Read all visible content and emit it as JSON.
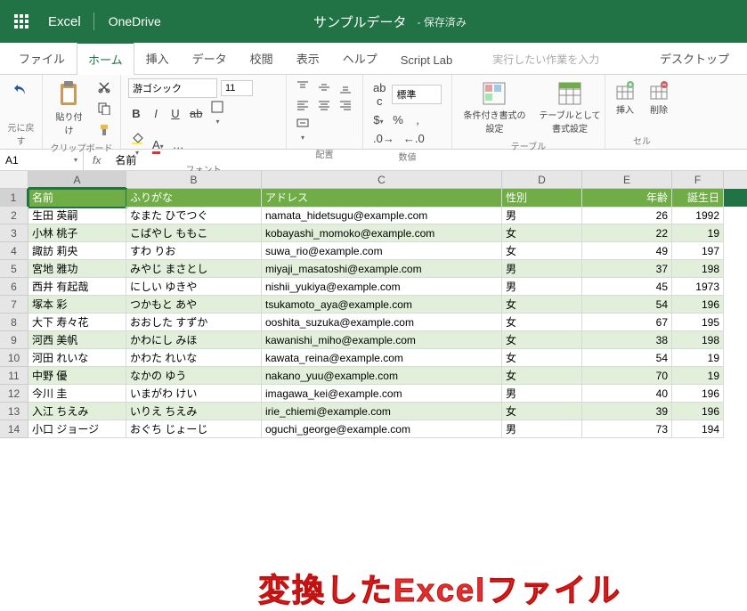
{
  "header": {
    "app": "Excel",
    "brand": "OneDrive",
    "title": "サンプルデータ",
    "status": "- 保存済み"
  },
  "tabs": [
    "ファイル",
    "ホーム",
    "挿入",
    "データ",
    "校閲",
    "表示",
    "ヘルプ",
    "Script Lab"
  ],
  "tellme": "実行したい作業を入力",
  "tabRight": "デスクトップ",
  "ribbon": {
    "undo": "元に戻す",
    "clipboard": {
      "paste": "貼り付け",
      "label": "クリップボード"
    },
    "font": {
      "name": "游ゴシック",
      "size": "11",
      "label": "フォント"
    },
    "align": {
      "label": "配置"
    },
    "number": {
      "style": "標準",
      "label": "数値"
    },
    "table": {
      "cond": "条件付き書式の設定",
      "asTable": "テーブルとして\n書式設定",
      "label": "テーブル"
    },
    "cell": {
      "insert": "挿入",
      "delete": "削除",
      "label": "セル"
    }
  },
  "fbar": {
    "ref": "A1",
    "val": "名前"
  },
  "cols": [
    "A",
    "B",
    "C",
    "D",
    "E",
    "F"
  ],
  "headRow": [
    "名前",
    "ふりがな",
    "アドレス",
    "性別",
    "年齢",
    "誕生日"
  ],
  "rows": [
    [
      "生田 英嗣",
      "なまた ひでつぐ",
      "namata_hidetsugu@example.com",
      "男",
      "26",
      "1992"
    ],
    [
      "小林 桃子",
      "こばやし ももこ",
      "kobayashi_momoko@example.com",
      "女",
      "22",
      "19"
    ],
    [
      "諏訪 莉央",
      "すわ りお",
      "suwa_rio@example.com",
      "女",
      "49",
      "197"
    ],
    [
      "宮地 雅功",
      "みやじ まさとし",
      "miyaji_masatoshi@example.com",
      "男",
      "37",
      "198"
    ],
    [
      "西井 有起哉",
      "にしい ゆきや",
      "nishii_yukiya@example.com",
      "男",
      "45",
      "1973"
    ],
    [
      "塚本 彩",
      "つかもと あや",
      "tsukamoto_aya@example.com",
      "女",
      "54",
      "196"
    ],
    [
      "大下 寿々花",
      "おおした すずか",
      "ooshita_suzuka@example.com",
      "女",
      "67",
      "195"
    ],
    [
      "河西 美帆",
      "かわにし みほ",
      "kawanishi_miho@example.com",
      "女",
      "38",
      "198"
    ],
    [
      "河田 れいな",
      "かわた れいな",
      "kawata_reina@example.com",
      "女",
      "54",
      "19"
    ],
    [
      "中野 優",
      "なかの ゆう",
      "nakano_yuu@example.com",
      "女",
      "70",
      "19"
    ],
    [
      "今川 圭",
      "いまがわ けい",
      "imagawa_kei@example.com",
      "男",
      "40",
      "196"
    ],
    [
      "入江 ちえみ",
      "いりえ ちえみ",
      "irie_chiemi@example.com",
      "女",
      "39",
      "196"
    ],
    [
      "小口 ジョージ",
      "おぐち じょーじ",
      "oguchi_george@example.com",
      "男",
      "73",
      "194"
    ]
  ],
  "overlay": "変換したExcelファイル"
}
